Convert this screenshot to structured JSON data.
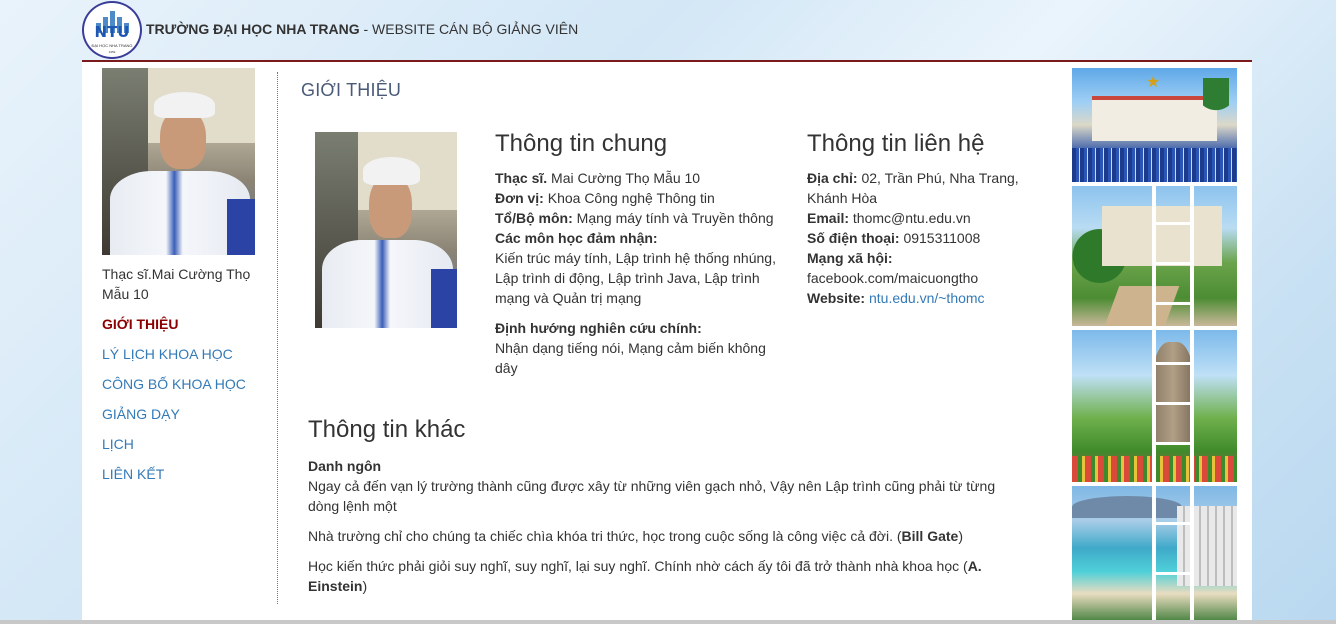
{
  "header": {
    "logo_text": "NTU",
    "logo_subtext": "ĐẠI HỌC NHA TRANG",
    "logo_year": "1959",
    "university": "TRƯỜNG ĐẠI HỌC NHA TRANG",
    "separator": " - ",
    "site_name": "WEBSITE CÁN BỘ GIẢNG VIÊN"
  },
  "sidebar": {
    "name": "Thạc sĩ.Mai Cường Thọ Mẫu 10",
    "nav": [
      {
        "label": "GIỚI THIỆU",
        "active": true
      },
      {
        "label": "LÝ LỊCH KHOA HỌC",
        "active": false
      },
      {
        "label": "CÔNG BỐ KHOA HỌC",
        "active": false
      },
      {
        "label": "GIẢNG DẠY",
        "active": false
      },
      {
        "label": "LỊCH",
        "active": false
      },
      {
        "label": "LIÊN KẾT",
        "active": false
      }
    ]
  },
  "page_title": "GIỚI THIỆU",
  "general": {
    "heading": "Thông tin chung",
    "degree_label": "Thạc sĩ.",
    "degree_value": " Mai Cường Thọ Mẫu 10",
    "unit_label": "Đơn vị:",
    "unit_value": " Khoa Công nghệ Thông tin",
    "dept_label": "Tổ/Bộ môn:",
    "dept_value": " Mạng máy tính và Truyền thông",
    "courses_label": "Các môn học đảm nhận:",
    "courses_value": "Kiến trúc máy tính, Lập trình hệ thống nhúng, Lập trình di động, Lập trình Java, Lập trình mạng và Quản trị mạng",
    "research_label": "Định hướng nghiên cứu chính:",
    "research_value": "Nhận dạng tiếng nói, Mạng cảm biến không dây"
  },
  "contact": {
    "heading": "Thông tin liên hệ",
    "address_label": "Địa chỉ:",
    "address_value": " 02, Trần Phú, Nha Trang, Khánh Hòa",
    "email_label": "Email:",
    "email_value": " thomc@ntu.edu.vn",
    "phone_label": "Số điện thoại:",
    "phone_value": " 0915311008",
    "social_label": "Mạng xã hội:",
    "social_value": "facebook.com/maicuongtho",
    "website_label": "Website:",
    "website_value": "ntu.edu.vn/~thomc"
  },
  "other": {
    "heading": "Thông tin khác",
    "quote_label": "Danh ngôn",
    "quote1": "Ngay cả đến vạn lý trường thành cũng được xây từ những viên gạch nhỏ, Vậy nên Lập trình cũng phải từ từng dòng lệnh một",
    "quote2_text": "Nhà trường chỉ cho chúng ta chiếc chìa khóa tri thức, học trong cuộc sống là công việc cả đời. (",
    "quote2_author": "Bill Gate",
    "quote2_end": ")",
    "quote3_text": " Học kiến thức phải giỏi suy nghĩ, suy nghĩ, lại suy nghĩ. Chính nhờ cách ấy tôi đã trở thành nhà khoa học (",
    "quote3_author": "A. Einstein",
    "quote3_end": ")"
  },
  "colors": {
    "link": "#337ab7",
    "active_nav": "#8b0000",
    "header_rule": "#7a1a1a",
    "title": "#4a5a78"
  }
}
